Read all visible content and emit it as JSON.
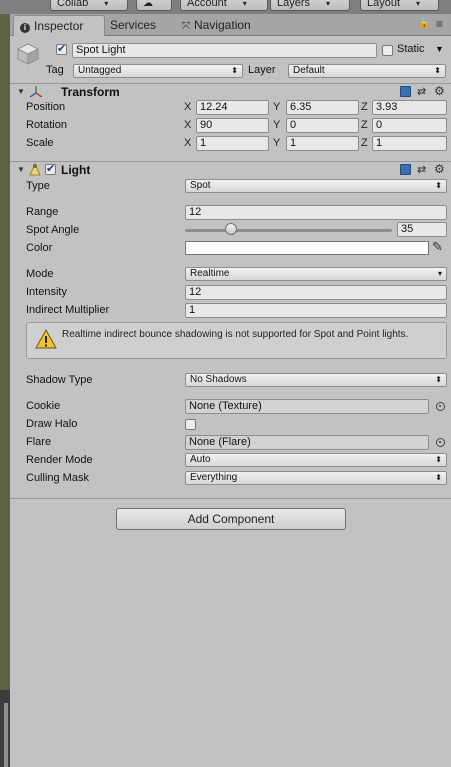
{
  "toolbar": {
    "collab_label": "Collab",
    "account_label": "Account",
    "layers_label": "Layers",
    "layout_label": "Layout"
  },
  "tabs": [
    {
      "label": "Inspector",
      "active": true
    },
    {
      "label": "Services",
      "active": false
    },
    {
      "label": "Navigation",
      "active": false
    }
  ],
  "gameobject": {
    "enabled": true,
    "name": "Spot Light",
    "static_label": "Static",
    "static_checked": false,
    "tag_label": "Tag",
    "tag_value": "Untagged",
    "layer_label": "Layer",
    "layer_value": "Default"
  },
  "transform": {
    "title": "Transform",
    "position_label": "Position",
    "rotation_label": "Rotation",
    "scale_label": "Scale",
    "axis_x": "X",
    "axis_y": "Y",
    "axis_z": "Z",
    "position": {
      "x": "12.24",
      "y": "6.35",
      "z": "3.93"
    },
    "rotation": {
      "x": "90",
      "y": "0",
      "z": "0"
    },
    "scale": {
      "x": "1",
      "y": "1",
      "z": "1"
    }
  },
  "light": {
    "title": "Light",
    "enabled": true,
    "type_label": "Type",
    "type_value": "Spot",
    "range_label": "Range",
    "range_value": "12",
    "spot_angle_label": "Spot Angle",
    "spot_angle_value": "35",
    "spot_angle_fraction": 0.222,
    "color_label": "Color",
    "color_value": "#ffffff",
    "mode_label": "Mode",
    "mode_value": "Realtime",
    "intensity_label": "Intensity",
    "intensity_value": "12",
    "indirect_label": "Indirect Multiplier",
    "indirect_value": "1",
    "warning_text": "Realtime indirect bounce shadowing is not supported for Spot and Point lights.",
    "shadow_type_label": "Shadow Type",
    "shadow_type_value": "No Shadows",
    "cookie_label": "Cookie",
    "cookie_value": "None (Texture)",
    "draw_halo_label": "Draw Halo",
    "draw_halo_checked": false,
    "flare_label": "Flare",
    "flare_value": "None (Flare)",
    "render_mode_label": "Render Mode",
    "render_mode_value": "Auto",
    "culling_mask_label": "Culling Mask",
    "culling_mask_value": "Everything"
  },
  "add_component_label": "Add Component",
  "colors": {
    "panel_bg": "#c2c2c2",
    "accent_blue": "#3a6fb0",
    "warning_yellow": "#f1c232"
  }
}
